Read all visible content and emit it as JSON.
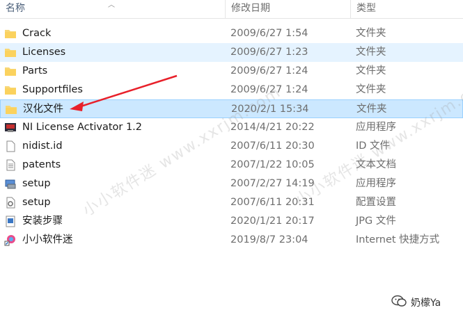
{
  "header": {
    "name_label": "名称",
    "date_label": "修改日期",
    "type_label": "类型"
  },
  "files": [
    {
      "name": "Crack",
      "date": "2009/6/27 1:54",
      "type": "文件夹",
      "icon": "folder-icon"
    },
    {
      "name": "Licenses",
      "date": "2009/6/27 1:23",
      "type": "文件夹",
      "icon": "folder-icon"
    },
    {
      "name": "Parts",
      "date": "2009/6/27 1:24",
      "type": "文件夹",
      "icon": "folder-icon"
    },
    {
      "name": "Supportfiles",
      "date": "2009/6/27 1:24",
      "type": "文件夹",
      "icon": "folder-icon"
    },
    {
      "name": "汉化文件",
      "date": "2020/2/1 15:34",
      "type": "文件夹",
      "icon": "folder-icon"
    },
    {
      "name": "NI License Activator 1.2",
      "date": "2014/4/21 20:22",
      "type": "应用程序",
      "icon": "activator-app-icon"
    },
    {
      "name": "nidist.id",
      "date": "2007/6/11 20:30",
      "type": "ID 文件",
      "icon": "blank-file-icon"
    },
    {
      "name": "patents",
      "date": "2007/1/22 10:05",
      "type": "文本文档",
      "icon": "text-file-icon"
    },
    {
      "name": "setup",
      "date": "2007/2/27 14:19",
      "type": "应用程序",
      "icon": "setup-app-icon"
    },
    {
      "name": "setup",
      "date": "2007/6/11 20:31",
      "type": "配置设置",
      "icon": "config-file-icon"
    },
    {
      "name": "安装步骤",
      "date": "2020/1/21 20:17",
      "type": "JPG 文件",
      "icon": "image-file-icon"
    },
    {
      "name": "小小软件迷",
      "date": "2019/8/7 23:04",
      "type": "Internet 快捷方式",
      "icon": "internet-shortcut-icon"
    }
  ],
  "watermarks": [
    "小小软件迷 www.xxrjm.com",
    "小小软件迷 www.xxrjm.com"
  ],
  "wechat_label": "奶檬Ya",
  "colors": {
    "hover": "#e5f3ff",
    "selected": "#cce8ff",
    "folder": "#f8d775",
    "arrow": "#e8202a"
  }
}
